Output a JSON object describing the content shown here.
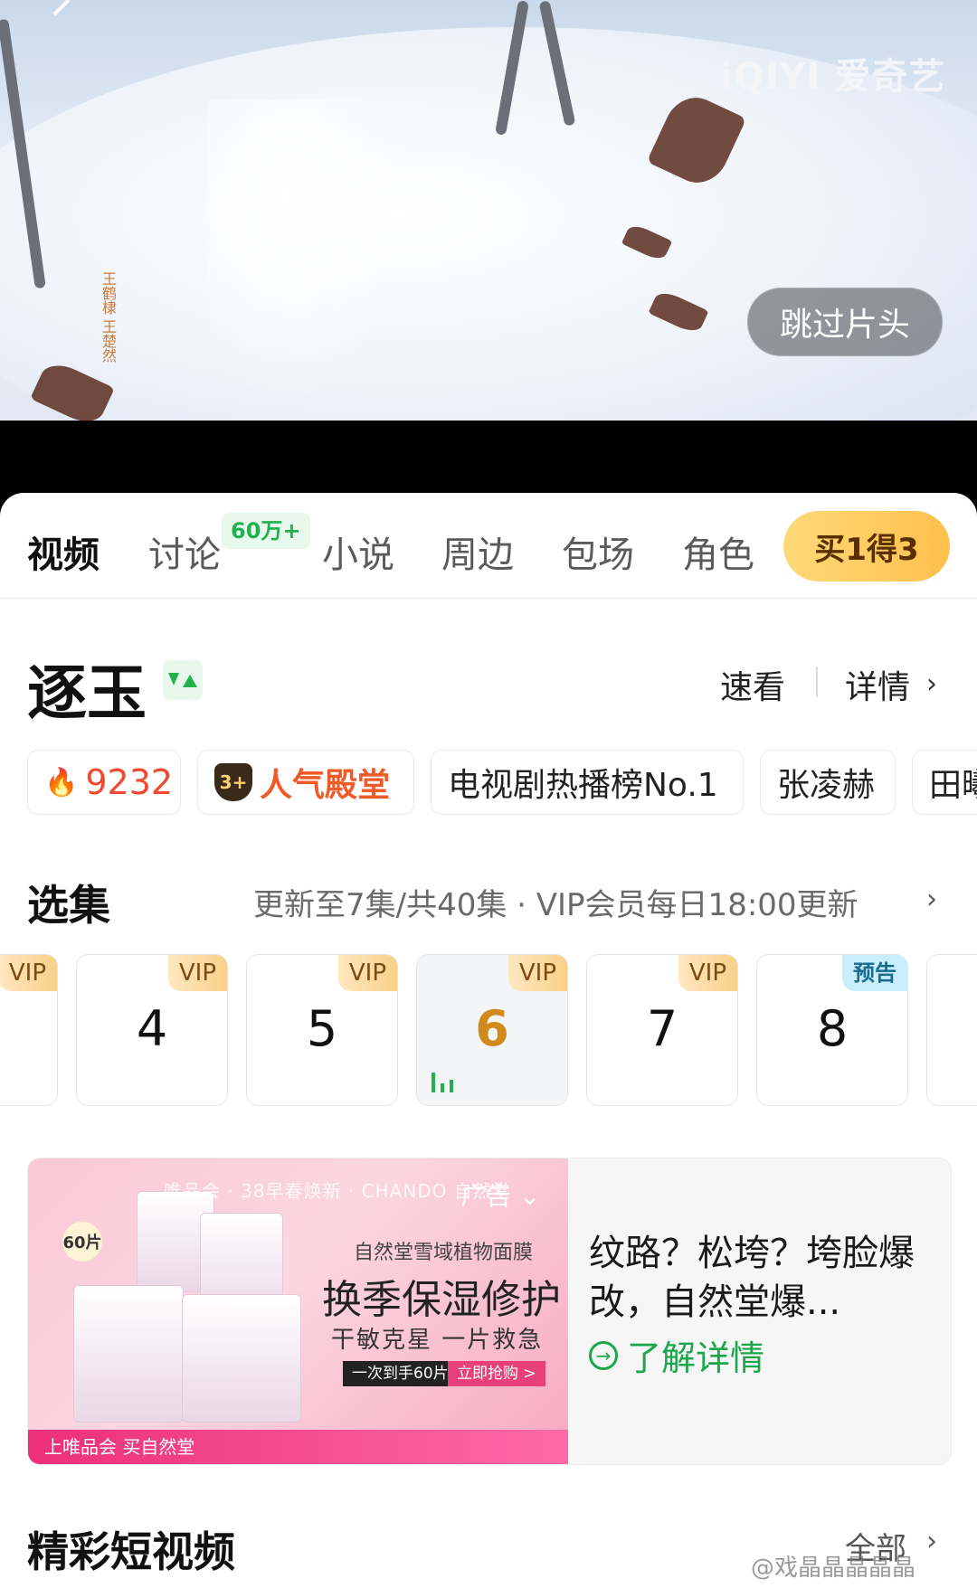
{
  "video": {
    "logo": "iQIYI 爱奇艺",
    "skip_label": "跳过片头",
    "credits": "王鹤棣 王楚然"
  },
  "tabs": [
    {
      "label": "视频",
      "active": true
    },
    {
      "label": "讨论",
      "badge": "60万+"
    },
    {
      "label": "小说"
    },
    {
      "label": "周边"
    },
    {
      "label": "包场"
    },
    {
      "label": "角色"
    }
  ],
  "promo_button": "买1得3",
  "show": {
    "title": "逐玉",
    "quick_watch": "速看",
    "details": "详情",
    "tags": [
      {
        "text": "9232",
        "icon": "flame-icon",
        "color": "#f0492f"
      },
      {
        "text": "人气殿堂",
        "icon": "crown-badge-icon",
        "color": "#f05a28"
      },
      {
        "text": "电视剧热播榜No.1"
      },
      {
        "text": "张凌赫"
      },
      {
        "text": "田曦"
      }
    ]
  },
  "episodes": {
    "title": "选集",
    "info": "更新至7集/共40集 · VIP会员每日18:00更新",
    "items": [
      {
        "num": "",
        "label": "VIP"
      },
      {
        "num": "4",
        "label": "VIP"
      },
      {
        "num": "5",
        "label": "VIP"
      },
      {
        "num": "6",
        "label": "VIP",
        "current": true
      },
      {
        "num": "7",
        "label": "VIP"
      },
      {
        "num": "8",
        "label": "预告"
      }
    ]
  },
  "ad": {
    "brand_line": "唯品会 · 38早春焕新 · CHANDO 自然堂",
    "label": "广告",
    "subtitle": "自然堂雪域植物面膜",
    "headline": "换季保湿修护",
    "slogan": "干敏克星 一片救急",
    "offer": "一次到手60片",
    "buy": "立即抢购 >",
    "count_badge": "60片",
    "bottom_banner": "上唯品会 买自然堂",
    "title": "纹路？松垮？垮脸爆改，自然堂爆...",
    "link": "了解详情"
  },
  "short_videos": {
    "title": "精彩短视频",
    "all": "全部"
  },
  "watermark": "@戏晶晶晶晶晶"
}
